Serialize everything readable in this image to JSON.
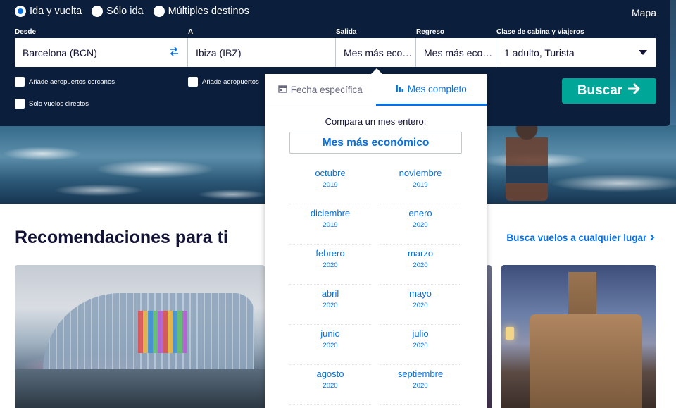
{
  "trip_types": [
    {
      "label": "Ida y vuelta",
      "selected": true
    },
    {
      "label": "Sólo ida",
      "selected": false
    },
    {
      "label": "Múltiples destinos",
      "selected": false
    }
  ],
  "map_link": "Mapa",
  "fields": {
    "from_label": "Desde",
    "from_value": "Barcelona (BCN)",
    "to_label": "A",
    "to_value": "Ibiza (IBZ)",
    "depart_label": "Salida",
    "depart_value": "Mes más eco…",
    "return_label": "Regreso",
    "return_value": "Mes más eco…",
    "cabin_label": "Clase de cabina y viajeros",
    "cabin_value": "1 adulto, Turista"
  },
  "checkboxes": {
    "nearby_from": "Añade aeropuertos cercanos",
    "nearby_to": "Añade aeropuertos",
    "direct_only": "Solo vuelos directos"
  },
  "search_button": "Buscar",
  "dropdown": {
    "tab_specific": "Fecha específica",
    "tab_month": "Mes completo",
    "compare_text": "Compara un mes entero:",
    "cheapest_button": "Mes más económico",
    "months": [
      {
        "name": "octubre",
        "year": "2019"
      },
      {
        "name": "noviembre",
        "year": "2019"
      },
      {
        "name": "diciembre",
        "year": "2019"
      },
      {
        "name": "enero",
        "year": "2020"
      },
      {
        "name": "febrero",
        "year": "2020"
      },
      {
        "name": "marzo",
        "year": "2020"
      },
      {
        "name": "abril",
        "year": "2020"
      },
      {
        "name": "mayo",
        "year": "2020"
      },
      {
        "name": "junio",
        "year": "2020"
      },
      {
        "name": "julio",
        "year": "2020"
      },
      {
        "name": "agosto",
        "year": "2020"
      },
      {
        "name": "septiembre",
        "year": "2020"
      }
    ]
  },
  "recommendations": {
    "title": "Recomendaciones para ti",
    "link": "Busca vuelos a cualquier lugar"
  },
  "colors": {
    "panel": "#0b1e3b",
    "accent": "#0770e3",
    "search_button": "#00a698"
  },
  "icons": {
    "swap": "swap-arrows-icon",
    "calendar": "calendar-icon",
    "bar_chart": "bar-chart-icon",
    "arrow_right": "arrow-right-icon",
    "chevron_right": "chevron-right-icon",
    "caret_down": "caret-down-icon"
  }
}
